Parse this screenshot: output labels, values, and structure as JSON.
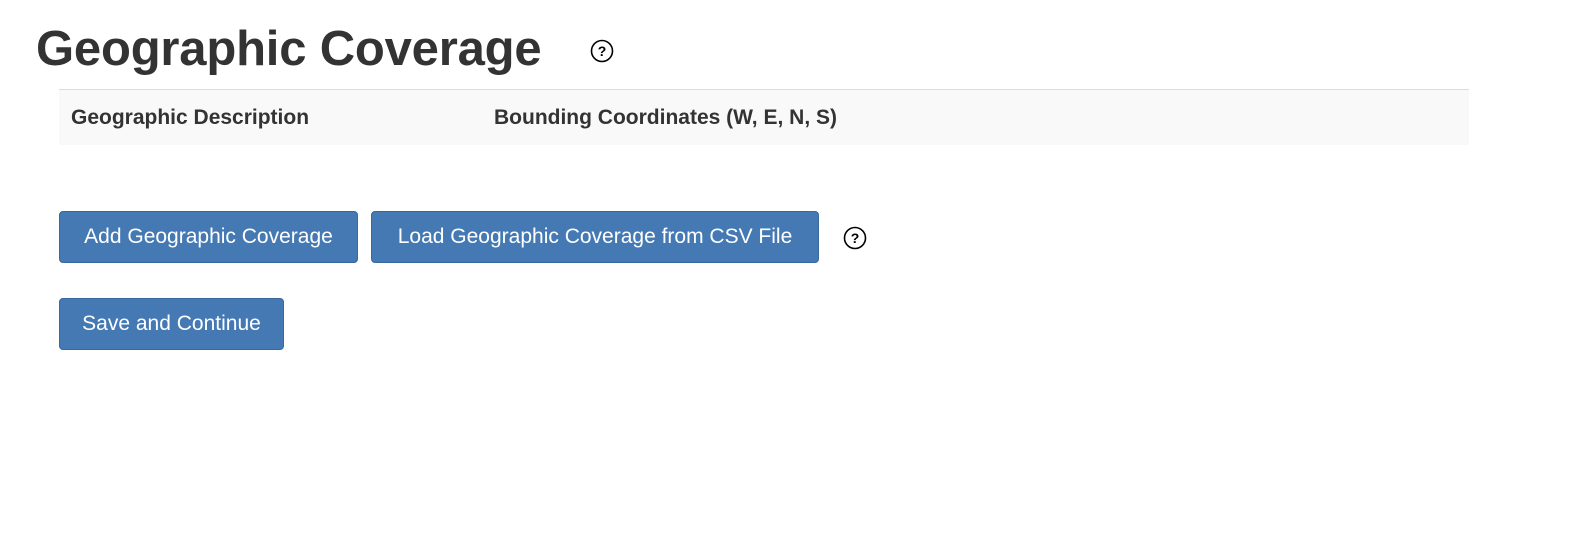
{
  "header": {
    "title": "Geographic Coverage",
    "help_icon": "question-circle-icon"
  },
  "table": {
    "columns": [
      "Geographic Description",
      "Bounding Coordinates (W, E, N, S)"
    ],
    "rows": []
  },
  "actions": {
    "add_label": "Add Geographic Coverage",
    "load_label": "Load Geographic Coverage from CSV File",
    "load_help_icon": "question-circle-icon",
    "save_label": "Save and Continue"
  },
  "colors": {
    "button_primary": "#4479b4",
    "button_text": "#ffffff",
    "title_text": "#333333",
    "table_header_bg": "#f9f9f9",
    "table_border": "#dddddd"
  }
}
